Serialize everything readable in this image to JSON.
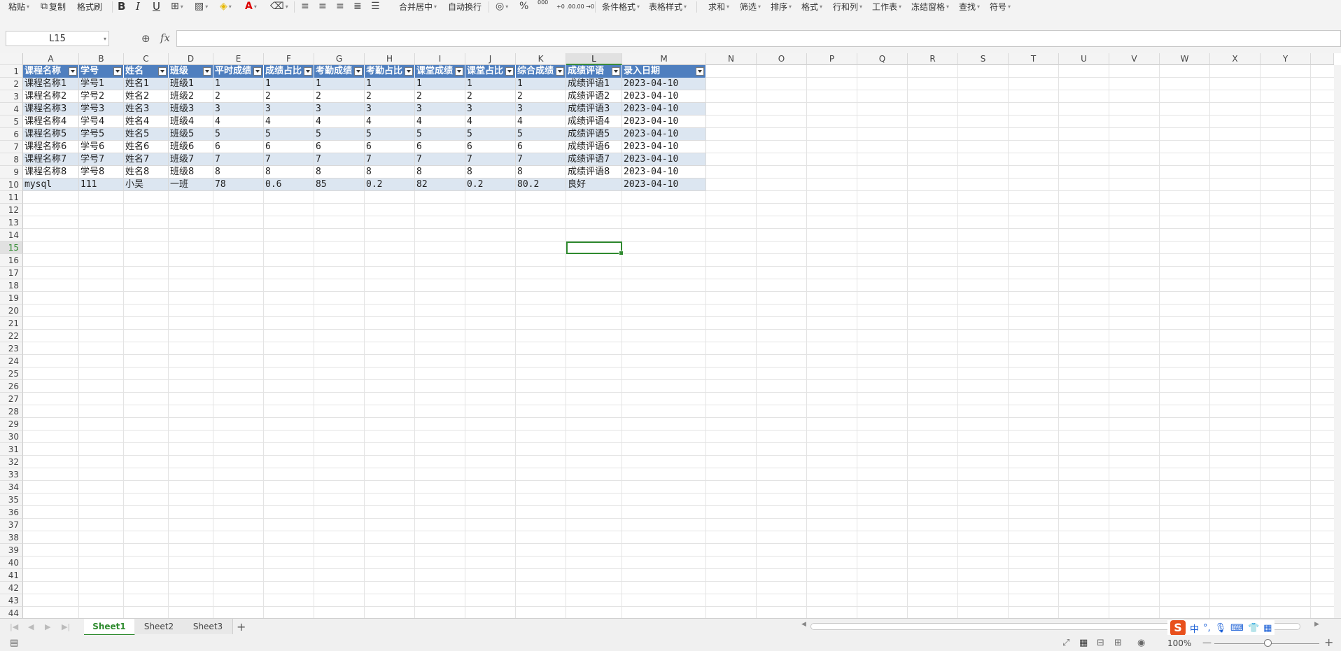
{
  "toolbar": {
    "paste": "粘贴",
    "copy": "复制",
    "format_painter": "格式刷",
    "merge_center": "合并居中",
    "auto_wrap": "自动换行",
    "conditional_format": "条件格式",
    "table_style": "表格样式",
    "sum": "求和",
    "filter": "筛选",
    "sort": "排序",
    "format": "格式",
    "row_col": "行和列",
    "worksheet": "工作表",
    "freeze": "冻结窗格",
    "find": "查找",
    "symbol": "符号",
    "bold_icon": "B",
    "italic_icon": "I",
    "underline_icon": "U",
    "percent_icon": "%",
    "thousands_icon": "000",
    "inc_decimal_icon": "+0 .00",
    "dec_decimal_icon": ".00 →0"
  },
  "formula_bar": {
    "name_box": "L15",
    "fx": "fx",
    "value": ""
  },
  "columns": [
    "A",
    "B",
    "C",
    "D",
    "E",
    "F",
    "G",
    "H",
    "I",
    "J",
    "K",
    "L",
    "M",
    "N",
    "O",
    "P",
    "Q",
    "R",
    "S",
    "T",
    "U",
    "V",
    "W",
    "X",
    "Y"
  ],
  "selected_column": "L",
  "selected_row": 15,
  "row_count": 44,
  "table": {
    "headers": [
      "课程名称",
      "学号",
      "姓名",
      "班级",
      "平时成绩",
      "成绩占比",
      "考勤成绩",
      "考勤占比",
      "课堂成绩",
      "课堂占比",
      "综合成绩",
      "成绩评语",
      "录入日期"
    ],
    "rows": [
      [
        "课程名称1",
        "学号1",
        "姓名1",
        "班级1",
        "1",
        "1",
        "1",
        "1",
        "1",
        "1",
        "1",
        "成绩评语1",
        "2023-04-10"
      ],
      [
        "课程名称2",
        "学号2",
        "姓名2",
        "班级2",
        "2",
        "2",
        "2",
        "2",
        "2",
        "2",
        "2",
        "成绩评语2",
        "2023-04-10"
      ],
      [
        "课程名称3",
        "学号3",
        "姓名3",
        "班级3",
        "3",
        "3",
        "3",
        "3",
        "3",
        "3",
        "3",
        "成绩评语3",
        "2023-04-10"
      ],
      [
        "课程名称4",
        "学号4",
        "姓名4",
        "班级4",
        "4",
        "4",
        "4",
        "4",
        "4",
        "4",
        "4",
        "成绩评语4",
        "2023-04-10"
      ],
      [
        "课程名称5",
        "学号5",
        "姓名5",
        "班级5",
        "5",
        "5",
        "5",
        "5",
        "5",
        "5",
        "5",
        "成绩评语5",
        "2023-04-10"
      ],
      [
        "课程名称6",
        "学号6",
        "姓名6",
        "班级6",
        "6",
        "6",
        "6",
        "6",
        "6",
        "6",
        "6",
        "成绩评语6",
        "2023-04-10"
      ],
      [
        "课程名称7",
        "学号7",
        "姓名7",
        "班级7",
        "7",
        "7",
        "7",
        "7",
        "7",
        "7",
        "7",
        "成绩评语7",
        "2023-04-10"
      ],
      [
        "课程名称8",
        "学号8",
        "姓名8",
        "班级8",
        "8",
        "8",
        "8",
        "8",
        "8",
        "8",
        "8",
        "成绩评语8",
        "2023-04-10"
      ],
      [
        "mysql",
        "111",
        "小吴",
        "一班",
        "78",
        "0.6",
        "85",
        "0.2",
        "82",
        "0.2",
        "80.2",
        "良好",
        "2023-04-10"
      ]
    ]
  },
  "sheets": [
    "Sheet1",
    "Sheet2",
    "Sheet3"
  ],
  "active_sheet": "Sheet1",
  "add_sheet": "+",
  "ime": {
    "logo": "S",
    "lang": "中",
    "punct": "°,"
  },
  "status": {
    "zoom": "100%",
    "zoom_out": "—",
    "zoom_in": "+"
  },
  "colors": {
    "header_fill": "#4f7fbf",
    "band_fill": "#dce6f1",
    "selection": "#2f8a2f"
  }
}
